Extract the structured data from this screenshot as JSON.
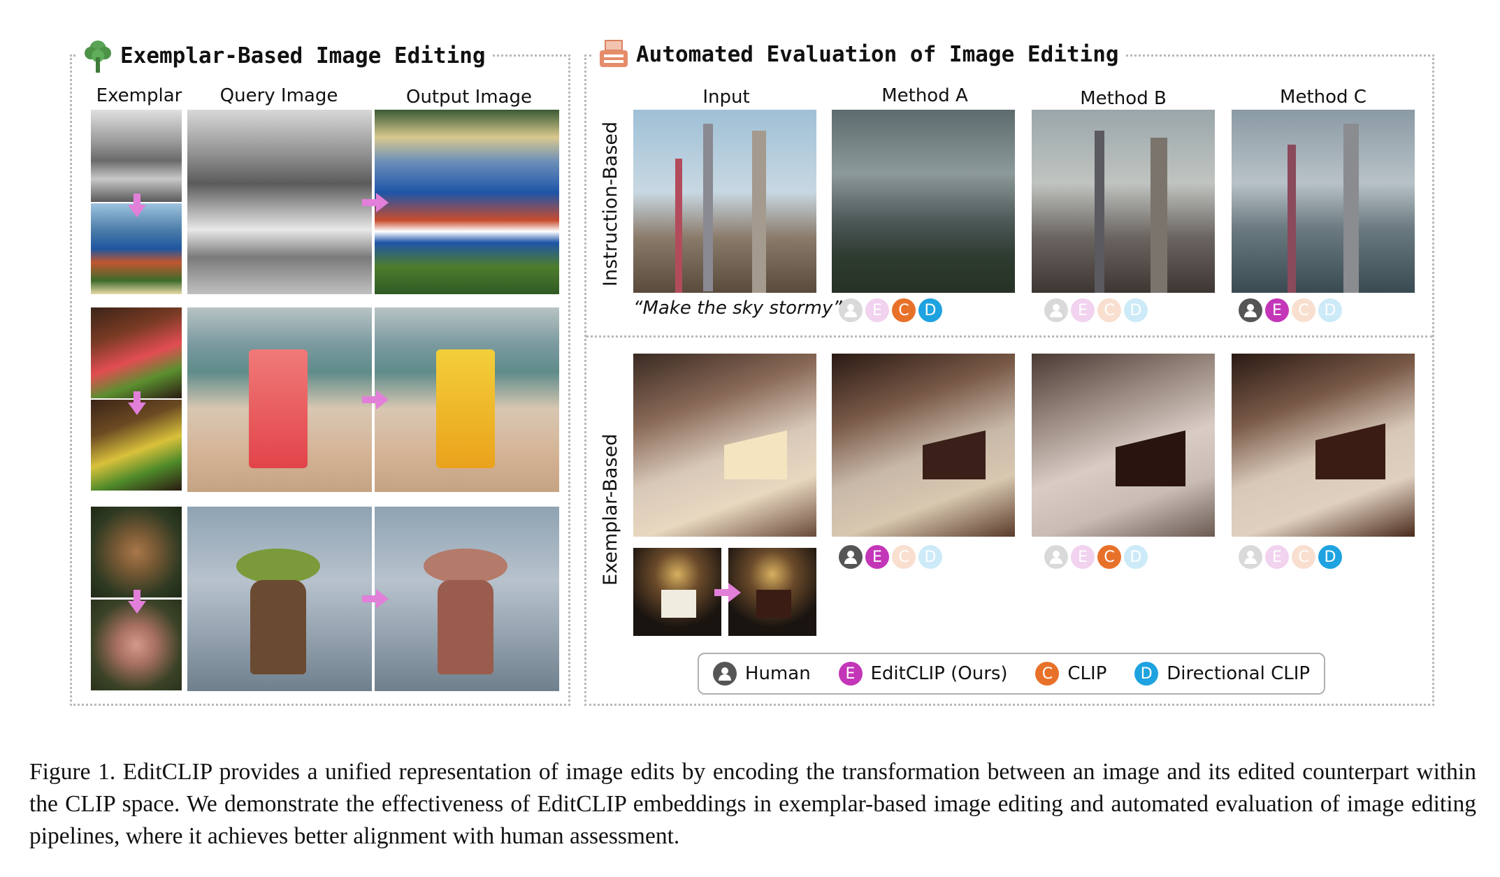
{
  "left_panel": {
    "title": "Exemplar-Based Image Editing",
    "col_labels": [
      "Exemplar",
      "Query Image",
      "Output Image"
    ]
  },
  "right_panel": {
    "title": "Automated Evaluation of Image Editing",
    "col_labels": [
      "Input",
      "Method A",
      "Method B",
      "Method C"
    ],
    "row_labels": [
      "Instruction-Based",
      "Exemplar-Based"
    ],
    "prompt": "“Make the sky stormy”",
    "circle_letters": {
      "human": "",
      "editclip": "E",
      "clip": "C",
      "directional": "D"
    },
    "colors": {
      "human": "#555555",
      "editclip": "#c336b8",
      "clip": "#e8712a",
      "directional": "#1ea2e0",
      "arrow": "#e27fd9"
    }
  },
  "legend": {
    "human": "Human",
    "editclip": "EditCLIP (Ours)",
    "clip": "CLIP",
    "directional": "Directional CLIP"
  },
  "caption": "Figure 1.  EditCLIP provides a unified representation of image edits by encoding the transformation between an image and its edited counterpart within the CLIP space.  We demonstrate the effectiveness of EditCLIP embeddings in exemplar-based image editing and automated evaluation of image editing pipelines, where it achieves better alignment with human assessment."
}
